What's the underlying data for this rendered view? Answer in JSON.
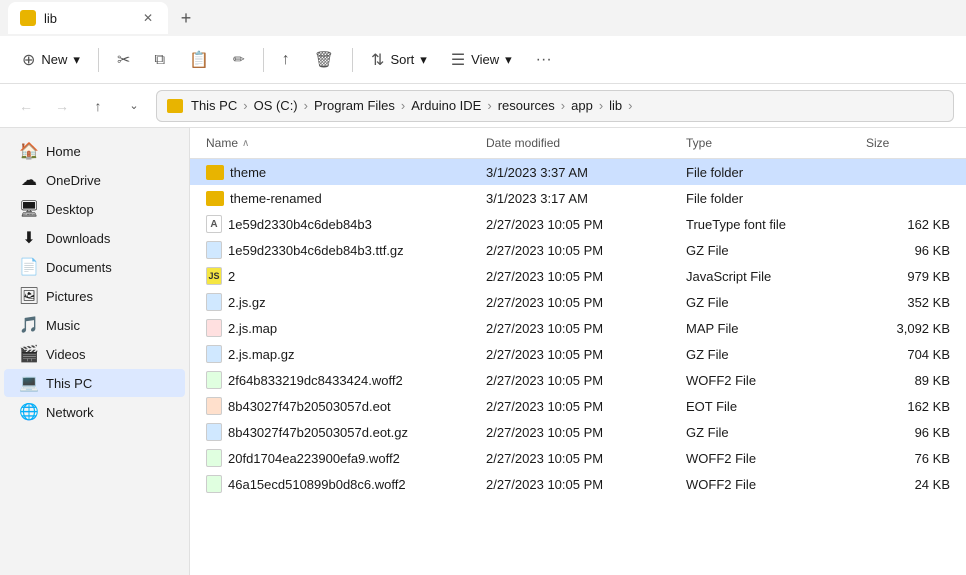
{
  "window": {
    "tab_title": "lib",
    "tab_new_label": "+"
  },
  "toolbar": {
    "new_label": "New",
    "new_icon": "⊕",
    "cut_icon": "✂",
    "copy_icon": "⧉",
    "paste_icon": "📋",
    "rename_icon": "✏",
    "share_icon": "↑",
    "delete_icon": "🗑",
    "sort_label": "Sort",
    "sort_icon": "⇅",
    "view_label": "View",
    "view_icon": "☰",
    "more_icon": "···"
  },
  "addressbar": {
    "breadcrumb": [
      {
        "label": "This PC"
      },
      {
        "label": "OS (C:)"
      },
      {
        "label": "Program Files"
      },
      {
        "label": "Arduino IDE"
      },
      {
        "label": "resources"
      },
      {
        "label": "app"
      },
      {
        "label": "lib"
      }
    ]
  },
  "sidebar": {
    "items": [
      {
        "id": "home",
        "label": "Home",
        "icon": "🏠",
        "pinned": false
      },
      {
        "id": "onedrive",
        "label": "OneDrive",
        "icon": "☁",
        "pinned": false
      },
      {
        "id": "desktop",
        "label": "Desktop",
        "icon": "🖥",
        "pinned": true
      },
      {
        "id": "downloads",
        "label": "Downloads",
        "icon": "⬇",
        "pinned": true
      },
      {
        "id": "documents",
        "label": "Documents",
        "icon": "📄",
        "pinned": true
      },
      {
        "id": "pictures",
        "label": "Pictures",
        "icon": "🖼",
        "pinned": true
      },
      {
        "id": "music",
        "label": "Music",
        "icon": "🎵",
        "pinned": true
      },
      {
        "id": "videos",
        "label": "Videos",
        "icon": "🎬",
        "pinned": true
      },
      {
        "id": "thispc",
        "label": "This PC",
        "icon": "💻",
        "active": true
      },
      {
        "id": "network",
        "label": "Network",
        "icon": "🌐"
      }
    ]
  },
  "filelist": {
    "columns": [
      {
        "id": "name",
        "label": "Name",
        "sort_arrow": "∧"
      },
      {
        "id": "modified",
        "label": "Date modified"
      },
      {
        "id": "type",
        "label": "Type"
      },
      {
        "id": "size",
        "label": "Size"
      }
    ],
    "rows": [
      {
        "name": "theme",
        "modified": "3/1/2023 3:37 AM",
        "type": "File folder",
        "size": "",
        "icon": "folder",
        "selected": true
      },
      {
        "name": "theme-renamed",
        "modified": "3/1/2023 3:17 AM",
        "type": "File folder",
        "size": "",
        "icon": "folder",
        "selected": false
      },
      {
        "name": "1e59d2330b4c6deb84b3",
        "modified": "2/27/2023 10:05 PM",
        "type": "TrueType font file",
        "size": "162 KB",
        "icon": "font",
        "selected": false
      },
      {
        "name": "1e59d2330b4c6deb84b3.ttf.gz",
        "modified": "2/27/2023 10:05 PM",
        "type": "GZ File",
        "size": "96 KB",
        "icon": "gz",
        "selected": false
      },
      {
        "name": "2",
        "modified": "2/27/2023 10:05 PM",
        "type": "JavaScript File",
        "size": "979 KB",
        "icon": "js",
        "selected": false
      },
      {
        "name": "2.js.gz",
        "modified": "2/27/2023 10:05 PM",
        "type": "GZ File",
        "size": "352 KB",
        "icon": "gz",
        "selected": false
      },
      {
        "name": "2.js.map",
        "modified": "2/27/2023 10:05 PM",
        "type": "MAP File",
        "size": "3,092 KB",
        "icon": "map",
        "selected": false
      },
      {
        "name": "2.js.map.gz",
        "modified": "2/27/2023 10:05 PM",
        "type": "GZ File",
        "size": "704 KB",
        "icon": "gz",
        "selected": false
      },
      {
        "name": "2f64b833219dc8433424.woff2",
        "modified": "2/27/2023 10:05 PM",
        "type": "WOFF2 File",
        "size": "89 KB",
        "icon": "woff",
        "selected": false
      },
      {
        "name": "8b43027f47b20503057d.eot",
        "modified": "2/27/2023 10:05 PM",
        "type": "EOT File",
        "size": "162 KB",
        "icon": "eot",
        "selected": false
      },
      {
        "name": "8b43027f47b20503057d.eot.gz",
        "modified": "2/27/2023 10:05 PM",
        "type": "GZ File",
        "size": "96 KB",
        "icon": "gz",
        "selected": false
      },
      {
        "name": "20fd1704ea223900efa9.woff2",
        "modified": "2/27/2023 10:05 PM",
        "type": "WOFF2 File",
        "size": "76 KB",
        "icon": "woff",
        "selected": false
      },
      {
        "name": "46a15ecd510899b0d8c6.woff2",
        "modified": "2/27/2023 10:05 PM",
        "type": "WOFF2 File",
        "size": "24 KB",
        "icon": "woff",
        "selected": false
      }
    ]
  }
}
